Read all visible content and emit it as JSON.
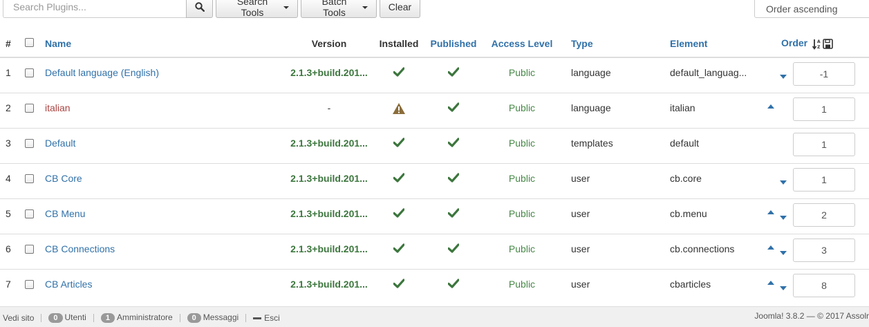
{
  "toolbar": {
    "search_placeholder": "Search Plugins...",
    "search_tools_label": "Search Tools",
    "batch_tools_label": "Batch Tools",
    "clear_label": "Clear",
    "order_select_value": "Order ascending"
  },
  "table": {
    "headers": {
      "num": "#",
      "name": "Name",
      "version": "Version",
      "installed": "Installed",
      "published": "Published",
      "access": "Access Level",
      "type": "Type",
      "element": "Element",
      "order": "Order"
    },
    "rows": [
      {
        "num": "1",
        "name": "Default language (English)",
        "version": "2.1.3+build.201...",
        "installed": "ok",
        "published": "ok",
        "access": "Public",
        "type": "language",
        "element": "default_languag...",
        "up": false,
        "down": true,
        "order": "-1"
      },
      {
        "num": "2",
        "name": "italian",
        "version": "-",
        "installed": "warning",
        "published": "ok",
        "access": "Public",
        "type": "language",
        "element": "italian",
        "up": true,
        "down": false,
        "order": "1"
      },
      {
        "num": "3",
        "name": "Default",
        "version": "2.1.3+build.201...",
        "installed": "ok",
        "published": "ok",
        "access": "Public",
        "type": "templates",
        "element": "default",
        "up": false,
        "down": false,
        "order": "1"
      },
      {
        "num": "4",
        "name": "CB Core",
        "version": "2.1.3+build.201...",
        "installed": "ok",
        "published": "ok",
        "access": "Public",
        "type": "user",
        "element": "cb.core",
        "up": false,
        "down": true,
        "order": "1"
      },
      {
        "num": "5",
        "name": "CB Menu",
        "version": "2.1.3+build.201...",
        "installed": "ok",
        "published": "ok",
        "access": "Public",
        "type": "user",
        "element": "cb.menu",
        "up": true,
        "down": true,
        "order": "2"
      },
      {
        "num": "6",
        "name": "CB Connections",
        "version": "2.1.3+build.201...",
        "installed": "ok",
        "published": "ok",
        "access": "Public",
        "type": "user",
        "element": "cb.connections",
        "up": true,
        "down": true,
        "order": "3"
      },
      {
        "num": "7",
        "name": "CB Articles",
        "version": "2.1.3+build.201...",
        "installed": "ok",
        "published": "ok",
        "access": "Public",
        "type": "user",
        "element": "cbarticles",
        "up": true,
        "down": true,
        "order": "8"
      }
    ]
  },
  "statusbar": {
    "view_site": "Vedi sito",
    "users_count": "0",
    "users_label": "Utenti",
    "admin_count": "1",
    "admin_label": "Amministratore",
    "messages_count": "0",
    "messages_label": "Messaggi",
    "logout_label": "Esci",
    "version_text": "Joomla! 3.8.2 — © 2017 Assolr"
  },
  "colors": {
    "link": "#3071a9",
    "success": "#3c763d",
    "warning": "#8a6d3b",
    "danger_link": "#a94442"
  }
}
